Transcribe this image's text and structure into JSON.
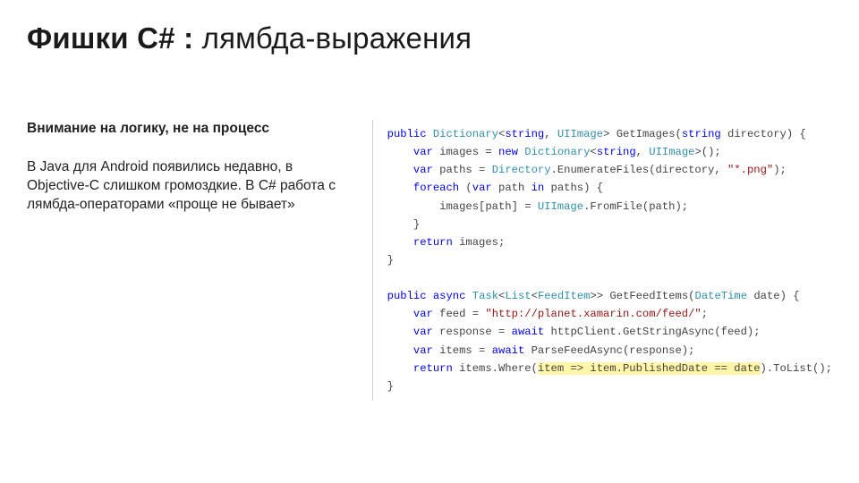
{
  "title": {
    "bold": "Фишки C# :",
    "light": " лямбда-выражения"
  },
  "left": {
    "subtitle": "Внимание на логику, не на процесс",
    "body": "В Java для Android появились недавно, в Objective-C слишком громоздкие. В C# работа с лямбда-операторами «проще не бывает»"
  },
  "code": {
    "block1": {
      "l1a": "public",
      "l1b": "Dictionary",
      "l1c": "string",
      "l1d": "UIImage",
      "l1e": "string",
      "sig_after": "> GetImages(",
      "sig_param": " directory) {",
      "l2a": "var",
      "l2b": "new",
      "l2c": "Dictionary",
      "l2d": "string",
      "l2e": "UIImage",
      "l3a": "var",
      "l3b": "Directory",
      "l3c": "\"*.png\"",
      "l4a": "foreach",
      "l4b": "var",
      "l4c": "in",
      "l5a": "UIImage",
      "l6a": "return"
    },
    "block2": {
      "l1a": "public",
      "l1b": "async",
      "l1c": "Task",
      "l1d": "List",
      "l1e": "FeedItem",
      "l1f": "DateTime",
      "l2a": "var",
      "l2b": "\"http://planet.xamarin.com/feed/\"",
      "l3a": "var",
      "l3b": "await",
      "l4a": "var",
      "l4b": "await",
      "l5a": "return",
      "l5hl": "item => item.PublishedDate == date"
    }
  }
}
